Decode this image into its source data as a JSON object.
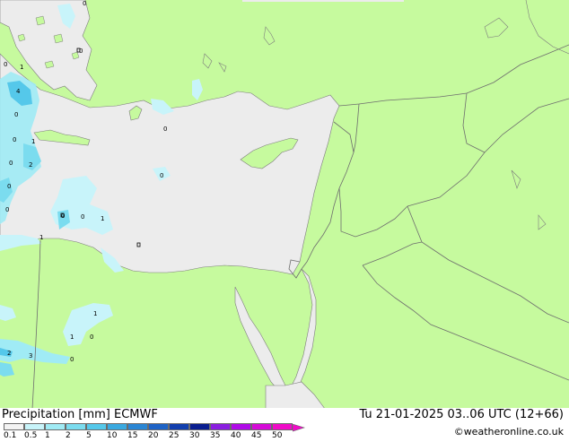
{
  "map": {
    "colors": {
      "land": "#c6fa9e",
      "sea": "#ececec",
      "border": "#6e6e6e",
      "coast": "#7d7d7d"
    },
    "point_labels": [
      "0",
      "0",
      "1",
      "4",
      "0",
      "0",
      "1",
      "0",
      "2",
      "0",
      "0",
      "0",
      "0",
      "0",
      "1",
      "0",
      "0",
      "1",
      "1",
      "1",
      "0",
      "2",
      "3",
      "0"
    ]
  },
  "footer": {
    "title": "Precipitation [mm]  ECMWF",
    "datetime": "Tu 21-01-2025 03..06 UTC (12+66)",
    "credit": "©weatheronline.co.uk"
  },
  "legend": {
    "ticks": [
      "0.1",
      "0.5",
      "1",
      "2",
      "5",
      "10",
      "15",
      "20",
      "25",
      "30",
      "35",
      "40",
      "45",
      "50"
    ],
    "colors": [
      "#f4f4f4",
      "#c8f4fa",
      "#a0ebf5",
      "#7bdcef",
      "#55c8ea",
      "#3aa9e0",
      "#2a86d4",
      "#1e63c6",
      "#123fae",
      "#0a1e90",
      "#8a1ee0",
      "#b00ae8",
      "#d60ad8",
      "#f00ac8"
    ]
  }
}
